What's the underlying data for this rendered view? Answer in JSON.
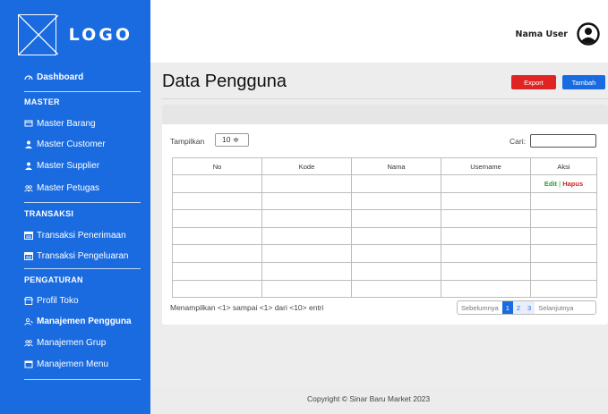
{
  "brand": {
    "logo_text": "LOGO"
  },
  "user": {
    "name": "Nama User"
  },
  "sidebar": {
    "dashboard": "Dashboard",
    "sections": [
      {
        "title": "MASTER",
        "items": [
          "Master Barang",
          "Master Customer",
          "Master Supplier",
          "Master Petugas"
        ]
      },
      {
        "title": "TRANSAKSI",
        "items": [
          "Transaksi Penerimaan",
          "Transaksi Pengeluaran"
        ]
      },
      {
        "title": "PENGATURAN",
        "items": [
          "Profil Toko",
          "Manajemen Pengguna",
          "Manajemen Grup",
          "Manajemen Menu"
        ]
      }
    ]
  },
  "page": {
    "title": "Data Pengguna",
    "export_label": "Export",
    "add_label": "Tambah"
  },
  "table_controls": {
    "show_label": "Tampilkan",
    "show_value": "10 ≑",
    "search_label": "Cari:"
  },
  "table": {
    "headers": [
      "No",
      "Kode",
      "Nama",
      "Username",
      "Aksi"
    ],
    "row_actions": {
      "edit": "Edit",
      "separator": "|",
      "delete": "Hapus"
    }
  },
  "pagination": {
    "info": "Menampilkan <1> sampai <1> dari <10> entri",
    "prev": "Sebelumnya",
    "pages": [
      "1",
      "2",
      "3"
    ],
    "next": "Selanjutnya"
  },
  "footer": {
    "copyright": "Copyright © Sinar Baru Market 2023"
  },
  "colors": {
    "primary": "#1a6be0",
    "danger": "#e02424",
    "success": "#2a9d2a"
  }
}
